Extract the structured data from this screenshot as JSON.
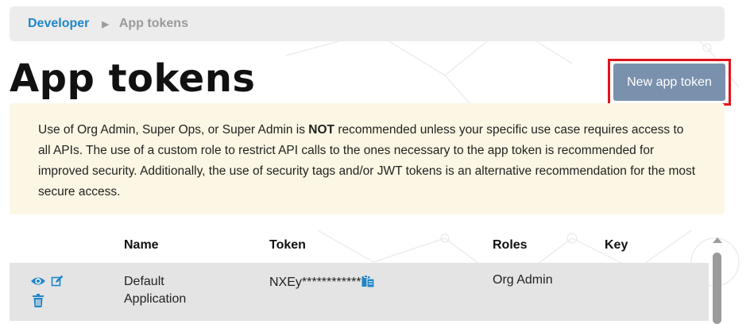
{
  "breadcrumb": {
    "parent": "Developer",
    "current": "App tokens"
  },
  "page": {
    "title": "App tokens",
    "new_button": "New app token"
  },
  "notice": {
    "prefix": "Use of Org Admin, Super Ops, or Super Admin is ",
    "emphasis": "NOT",
    "rest": " recommended unless your specific use case requires access to all APIs. The use of a custom role to restrict API calls to the ones necessary to the app token is recommended for improved security. Additionally, the use of security tags and/or JWT tokens is an alternative recommendation for the most secure access."
  },
  "table": {
    "headers": [
      "Name",
      "Token",
      "Roles",
      "Key"
    ],
    "rows": [
      {
        "name": "Default Application",
        "token": "NXEy************",
        "role": "Org Admin",
        "key": ""
      }
    ]
  },
  "icons": {
    "view": "eye-icon",
    "edit": "edit-icon",
    "delete": "trash-icon",
    "copy": "copy-icon"
  },
  "colors": {
    "accent": "#1f86c9",
    "button": "#7a91ad",
    "highlight": "#e2141b",
    "notice_bg": "#fcf7e4",
    "row_bg": "#e4e4e4"
  }
}
